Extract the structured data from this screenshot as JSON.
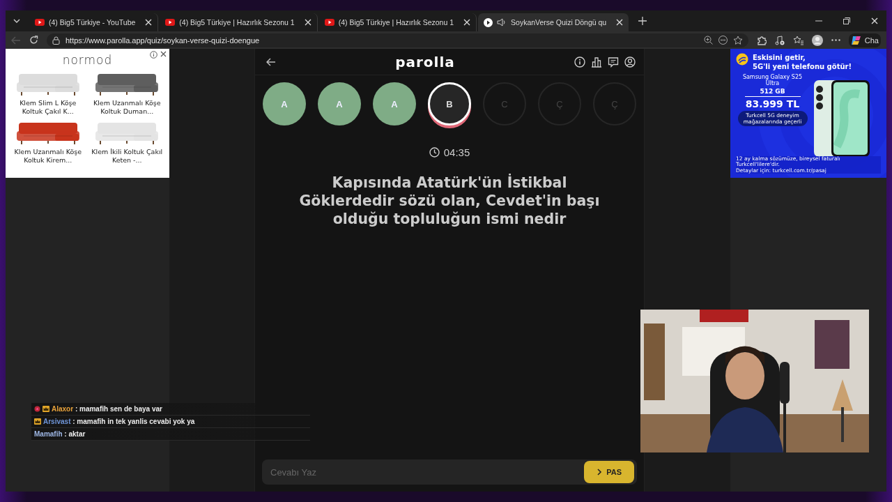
{
  "browser": {
    "tabs": [
      {
        "title": "(4) Big5 Türkiye - YouTube",
        "selected": false,
        "kind": "video",
        "audio": false
      },
      {
        "title": "(4) Big5 Türkiye | Hazırlık Sezonu 1",
        "selected": false,
        "kind": "video",
        "audio": false
      },
      {
        "title": "(4) Big5 Türkiye | Hazırlık Sezonu 1",
        "selected": false,
        "kind": "video",
        "audio": false
      },
      {
        "title": "SoykanVerse Quizi Döngü qu",
        "selected": true,
        "kind": "quiz",
        "audio": true
      }
    ],
    "url": "https://www.parolla.app/quiz/soykan-verse-quizi-doengue",
    "copilot": "Cha"
  },
  "ad_left": {
    "brand": "normod",
    "products": [
      {
        "caption": "Klem Slim L Köşe Koltuk Çakıl K...",
        "color": "#dcdcdc"
      },
      {
        "caption": "Klem Uzanmalı Köşe Koltuk Duman...",
        "color": "#5e5e5e"
      },
      {
        "caption": "Klem Uzanmalı Köşe Koltuk Kirem...",
        "color": "#c8341c"
      },
      {
        "caption": "Klem İkili Koltuk Çakıl Keten -...",
        "color": "#e4e4e4"
      }
    ]
  },
  "ad_right": {
    "headline": "Eskisini getir,\n5G'li yeni telefonu götür!",
    "model": "Samsung Galaxy S25 Ultra",
    "storage": "512 GB",
    "price": "83.999 TL",
    "badge": "Turkcell 5G deneyim mağazalarında geçerli",
    "footnote": "12 ay kalma sözümüze, bireysel faturalı Turkcell'lilere'dir.\nDetaylar için: turkcell.com.tr/pasaj"
  },
  "quiz": {
    "logo": "parolla",
    "letters": [
      {
        "letter": "A",
        "answered": true,
        "selected": false
      },
      {
        "letter": "A",
        "answered": true,
        "selected": false
      },
      {
        "letter": "A",
        "answered": true,
        "selected": false
      },
      {
        "letter": "B",
        "answered": false,
        "selected": true
      },
      {
        "letter": "C",
        "answered": false,
        "selected": false
      },
      {
        "letter": "Ç",
        "answered": false,
        "selected": false
      },
      {
        "letter": "Ç",
        "answered": false,
        "selected": false
      }
    ],
    "timer": "04:35",
    "question": "Kapısında Atatürk'ün İstikbal Göklerdedir sözü olan, Cevdet'in başı olduğu topluluğun ismi nedir",
    "answer": {
      "placeholder": "Cevabı Yaz"
    },
    "pass_button": "PAS"
  },
  "chat": {
    "messages": [
      {
        "user": "Alaxor",
        "text": ": mamafih sen de baya var",
        "color": "#e8a23a",
        "heart_badge": true,
        "crown_badge": true
      },
      {
        "user": "Arsivast",
        "text": ": mamafih in tek yanlis cevabi yok ya",
        "color": "#6f95d8",
        "heart_badge": false,
        "crown_badge": true
      },
      {
        "user": "Mamafih",
        "text": ": aktar",
        "color": "#9fb8e6",
        "heart_badge": false,
        "crown_badge": false
      }
    ]
  }
}
